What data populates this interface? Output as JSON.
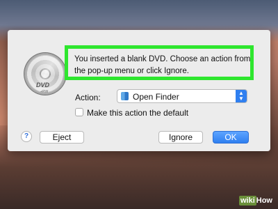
{
  "dialog": {
    "icon": "dvd-disc-icon",
    "dvd_logo": "DVD",
    "dvd_sub": "+RW",
    "message": "You inserted a blank DVD. Choose an action from the pop-up menu or click Ignore.",
    "action_label": "Action:",
    "action_value": "Open Finder",
    "checkbox_label": "Make this action the default",
    "help_label": "?",
    "eject_label": "Eject",
    "ignore_label": "Ignore",
    "ok_label": "OK"
  },
  "watermark": {
    "wiki": "wiki",
    "how": "How"
  },
  "colors": {
    "highlight": "#2ee62e",
    "accent": "#2f7ff0"
  }
}
